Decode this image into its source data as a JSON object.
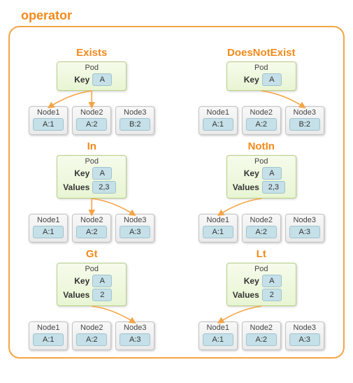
{
  "title": "operator",
  "pod_label": "Pod",
  "key_label": "Key",
  "values_label": "Values",
  "colors": {
    "accent": "#f28a1a",
    "border": "#f5a445",
    "pod_bg": "#e8f5d3",
    "tag": "#c5e0e8"
  },
  "operators": [
    {
      "name": "Exists",
      "key": "A",
      "values": null,
      "nodes": [
        {
          "name": "Node1",
          "val": "A:1",
          "match": true
        },
        {
          "name": "Node2",
          "val": "A:2",
          "match": true
        },
        {
          "name": "Node3",
          "val": "B:2",
          "match": false
        }
      ]
    },
    {
      "name": "DoesNotExist",
      "key": "A",
      "values": null,
      "nodes": [
        {
          "name": "Node1",
          "val": "A:1",
          "match": false
        },
        {
          "name": "Node2",
          "val": "A:2",
          "match": false
        },
        {
          "name": "Node3",
          "val": "B:2",
          "match": true
        }
      ]
    },
    {
      "name": "In",
      "key": "A",
      "values": "2,3",
      "nodes": [
        {
          "name": "Node1",
          "val": "A:1",
          "match": false
        },
        {
          "name": "Node2",
          "val": "A:2",
          "match": true
        },
        {
          "name": "Node3",
          "val": "A:3",
          "match": true
        }
      ]
    },
    {
      "name": "NotIn",
      "key": "A",
      "values": "2,3",
      "nodes": [
        {
          "name": "Node1",
          "val": "A:1",
          "match": true
        },
        {
          "name": "Node2",
          "val": "A:2",
          "match": false
        },
        {
          "name": "Node3",
          "val": "A:3",
          "match": false
        }
      ]
    },
    {
      "name": "Gt",
      "key": "A",
      "values": "2",
      "nodes": [
        {
          "name": "Node1",
          "val": "A:1",
          "match": false
        },
        {
          "name": "Node2",
          "val": "A:2",
          "match": false
        },
        {
          "name": "Node3",
          "val": "A:3",
          "match": true
        }
      ]
    },
    {
      "name": "Lt",
      "key": "A",
      "values": "2",
      "nodes": [
        {
          "name": "Node1",
          "val": "A:1",
          "match": true
        },
        {
          "name": "Node2",
          "val": "A:2",
          "match": false
        },
        {
          "name": "Node3",
          "val": "A:3",
          "match": false
        }
      ]
    }
  ]
}
